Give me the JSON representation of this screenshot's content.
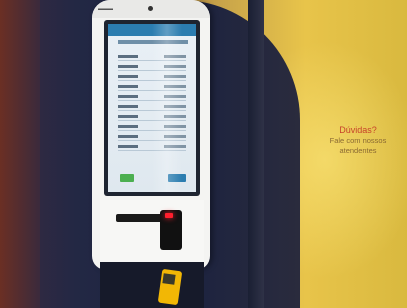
{
  "wall_sign": {
    "title": "Dúvidas?",
    "line1": "Fale com nossos",
    "line2": "atendentes"
  },
  "colors": {
    "wall": "#e8c44a",
    "sign_title": "#c7432a",
    "kiosk_body": "#f4f4f2",
    "reader_light": "#ff1e2d",
    "payment_terminal": "#f2b705"
  }
}
